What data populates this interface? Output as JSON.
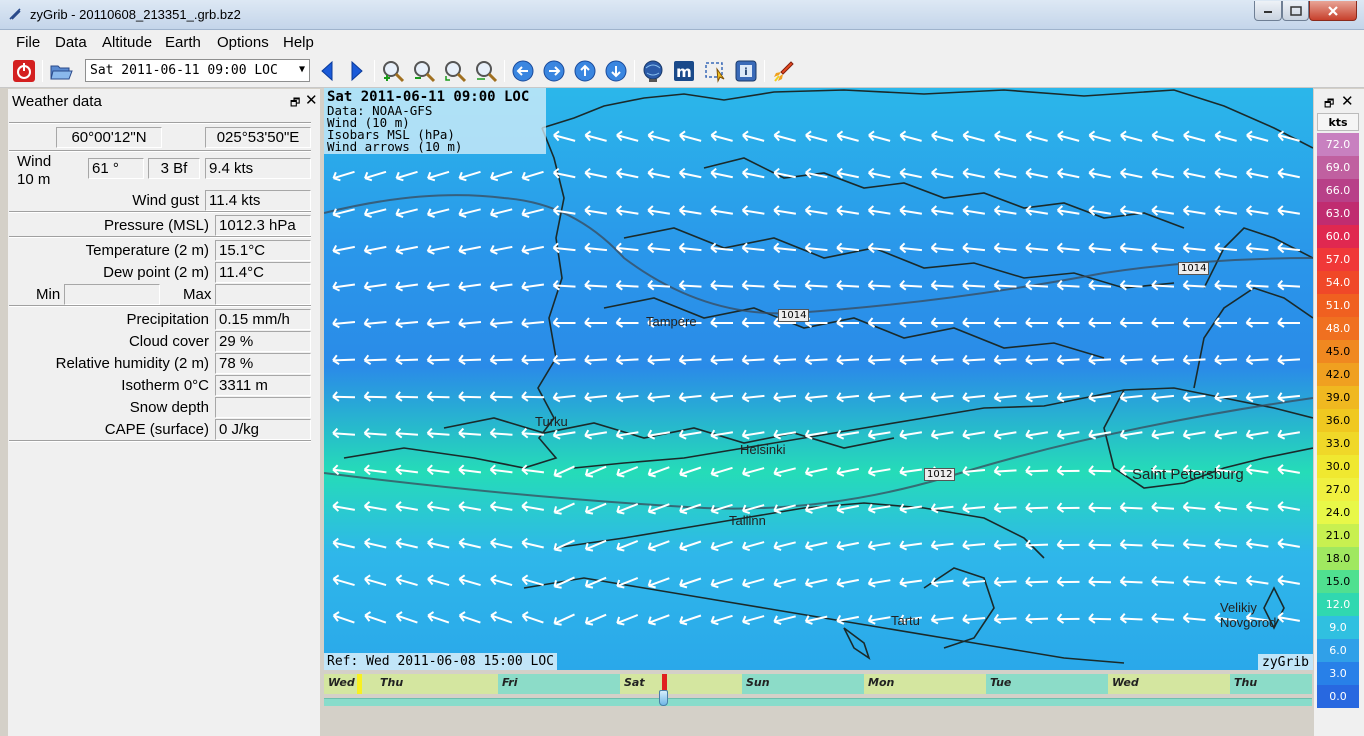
{
  "window": {
    "title": "zyGrib - 20110608_213351_.grb.bz2"
  },
  "menu": [
    "File",
    "Data",
    "Altitude",
    "Earth",
    "Options",
    "Help"
  ],
  "toolbar": {
    "date_value": "Sat 2011-06-11 09:00 LOC"
  },
  "weather_panel": {
    "title": "Weather data",
    "latitude": "60°00'12\"N",
    "longitude": "025°53'50\"E",
    "wind_label_1": "Wind",
    "wind_label_2": "10 m",
    "wind_dir": "61 °",
    "wind_bf": "3 Bf",
    "wind_speed": "9.4  kts",
    "wind_gust_label": "Wind gust",
    "wind_gust": "11.4  kts",
    "pressure_label": "Pressure (MSL)",
    "pressure": "1012.3 hPa",
    "temperature_label": "Temperature (2 m)",
    "temperature": "15.1°C",
    "dewpoint_label": "Dew point (2 m)",
    "dewpoint": "11.4°C",
    "min_label": "Min",
    "min_value": "",
    "max_label": "Max",
    "max_value": "",
    "precip_label": "Precipitation",
    "precip": "0.15 mm/h",
    "cloud_label": "Cloud cover",
    "cloud": " 29 %",
    "humidity_label": "Relative humidity (2 m)",
    "humidity": " 78 %",
    "isotherm_label": "Isotherm 0°C",
    "isotherm": "3311 m",
    "snow_label": "Snow depth",
    "snow": "",
    "cape_label": "CAPE (surface)",
    "cape": "0 J/kg"
  },
  "map": {
    "info_date": "Sat 2011-06-11 09:00 LOC",
    "info_lines": [
      "Data: NOAA-GFS",
      "Wind (10 m)",
      "Isobars MSL (hPa)",
      "Wind arrows (10 m)"
    ],
    "ref": "Ref: Wed 2011-06-08 15:00 LOC",
    "brand": "zyGrib",
    "cities": [
      "Tampere",
      "Turku",
      "Helsinki",
      "Tallinn",
      "Saint Petersburg",
      "Tartu",
      "Velikiy Novgorod"
    ],
    "isobar_labels": [
      "1014",
      "1014",
      "1012"
    ]
  },
  "timeline": {
    "days": [
      "Wed",
      "Thu",
      "Fri",
      "Sat",
      "Sun",
      "Mon",
      "Tue",
      "Wed",
      "Thu"
    ]
  },
  "scale": {
    "unit": "kts",
    "values": [
      "72.0",
      "69.0",
      "66.0",
      "63.0",
      "60.0",
      "57.0",
      "54.0",
      "51.0",
      "48.0",
      "45.0",
      "42.0",
      "39.0",
      "36.0",
      "33.0",
      "30.0",
      "27.0",
      "24.0",
      "21.0",
      "18.0",
      "15.0",
      "12.0",
      "9.0",
      "6.0",
      "3.0",
      "0.0"
    ],
    "colors": [
      "#c880c0",
      "#c060a0",
      "#b84088",
      "#c02c70",
      "#e02850",
      "#f03838",
      "#f04828",
      "#f06020",
      "#f07020",
      "#f08820",
      "#f0a020",
      "#f0b820",
      "#f0c820",
      "#f0d828",
      "#f0e830",
      "#f0f040",
      "#e8f848",
      "#c8f050",
      "#a0e860",
      "#50e090",
      "#30d8b0",
      "#30c0e0",
      "#30a0e8",
      "#2880e8",
      "#2868e0"
    ]
  }
}
